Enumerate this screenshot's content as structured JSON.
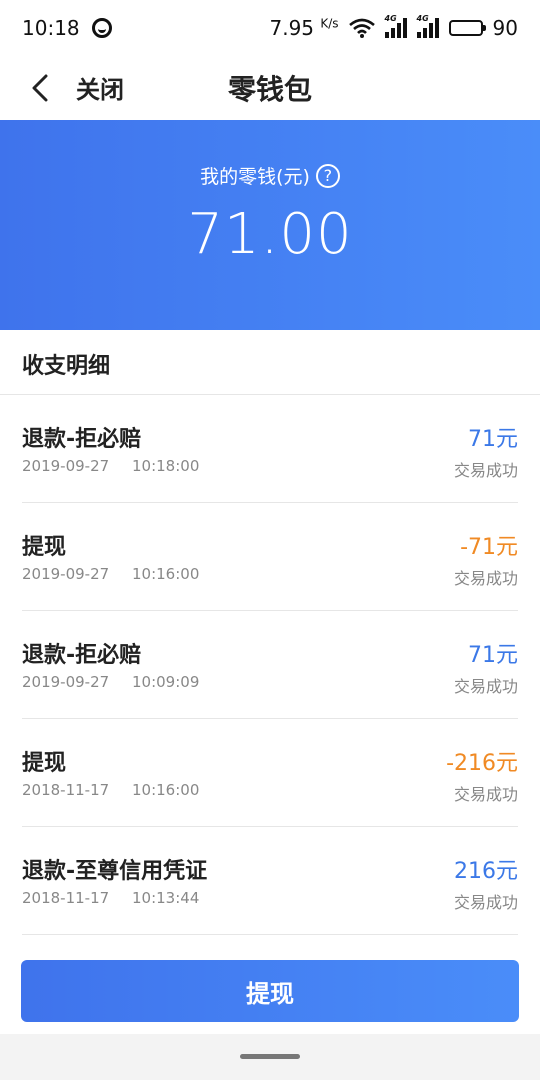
{
  "status_bar": {
    "time": "10:18",
    "speed_value": "7.95",
    "speed_unit": "K/s",
    "network_tag": "4G",
    "battery": "90"
  },
  "nav": {
    "close_label": "关闭",
    "title": "零钱包"
  },
  "balance": {
    "label": "我的零钱(元)",
    "help_glyph": "?",
    "amount": "71.00"
  },
  "section_title": "收支明细",
  "transactions": [
    {
      "title": "退款-拒必赔",
      "amount": "71元",
      "date": "2019-09-27",
      "time": "10:18:00",
      "status": "交易成功",
      "kind": "pos"
    },
    {
      "title": "提现",
      "amount": "-71元",
      "date": "2019-09-27",
      "time": "10:16:00",
      "status": "交易成功",
      "kind": "neg"
    },
    {
      "title": "退款-拒必赔",
      "amount": "71元",
      "date": "2019-09-27",
      "time": "10:09:09",
      "status": "交易成功",
      "kind": "pos"
    },
    {
      "title": "提现",
      "amount": "-216元",
      "date": "2018-11-17",
      "time": "10:16:00",
      "status": "交易成功",
      "kind": "neg"
    },
    {
      "title": "退款-至尊信用凭证",
      "amount": "216元",
      "date": "2018-11-17",
      "time": "10:13:44",
      "status": "交易成功",
      "kind": "pos"
    }
  ],
  "withdraw_button": "提现",
  "colors": {
    "accent_start": "#3f73ec",
    "accent_end": "#4a8df9",
    "positive": "#3b78e7",
    "negative": "#f08a24"
  }
}
